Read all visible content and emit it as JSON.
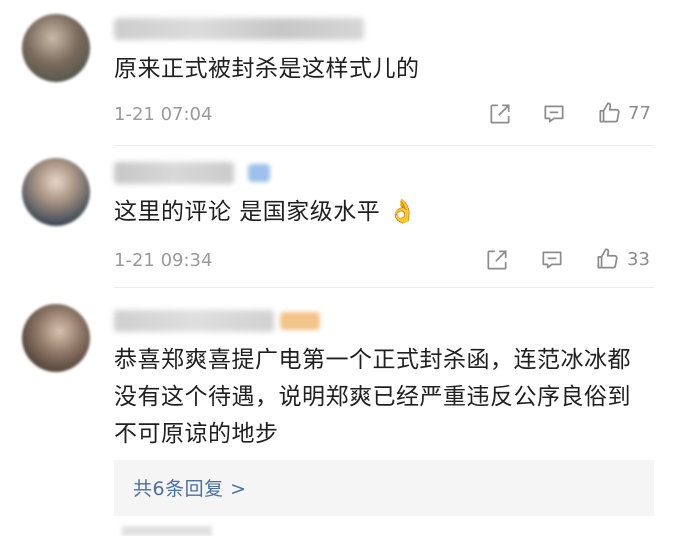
{
  "comments": [
    {
      "text": "原来正式被封杀是这样式儿的",
      "time": "1-21 07:04",
      "likes": "77"
    },
    {
      "text": "这里的评论 是国家级水平 👌",
      "time": "1-21 09:34",
      "likes": "33"
    },
    {
      "text": "恭喜郑爽喜提广电第一个正式封杀函，连范冰冰都没有这个待遇，说明郑爽已经严重违反公序良俗到不可原谅的地步"
    }
  ],
  "replies": {
    "label": "共6条回复 >"
  },
  "icons": {
    "share": "share-icon",
    "comment": "comment-icon",
    "like": "thumbs-up-icon"
  },
  "colors": {
    "link": "#4a6fa5",
    "meta": "#9a9a9a",
    "reply_bg": "#f5f5f5"
  }
}
